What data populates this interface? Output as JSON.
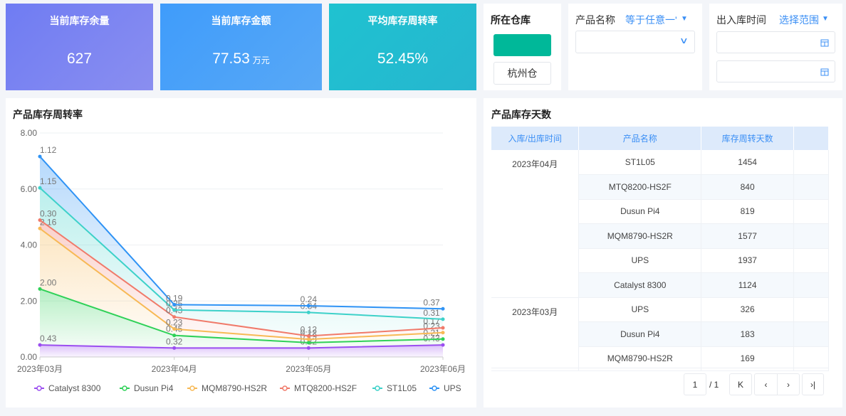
{
  "kpis": [
    {
      "title": "当前库存余量",
      "value": "627",
      "unit": ""
    },
    {
      "title": "当前库存金额",
      "value": "77.53",
      "unit": "万元"
    },
    {
      "title": "平均库存周转率",
      "value": "52.45%",
      "unit": ""
    }
  ],
  "filters": {
    "warehouse": {
      "label": "所在仓库",
      "option": "杭州仓"
    },
    "product": {
      "label": "产品名称",
      "mode": "等于任意一'",
      "value": ""
    },
    "time": {
      "label": "出入库时间",
      "mode": "选择范围",
      "start": "",
      "end": ""
    }
  },
  "chart_title": "产品库存周转率",
  "chart_data": {
    "type": "area",
    "stacked": true,
    "title": "产品库存周转率",
    "x": [
      "2023年03月",
      "2023年04月",
      "2023年05月",
      "2023年06月"
    ],
    "ylim": [
      0,
      8
    ],
    "yticks": [
      "0.00",
      "2.00",
      "4.00",
      "6.00",
      "8.00"
    ],
    "legend_position": "bottom",
    "series": [
      {
        "name": "Catalyst 8300",
        "color": "#9b4ef0",
        "values": [
          0.43,
          0.32,
          0.32,
          0.43
        ]
      },
      {
        "name": "Dusun Pi4",
        "color": "#2fd158",
        "values": [
          2.0,
          0.45,
          0.19,
          0.21
        ]
      },
      {
        "name": "MQM8790-HS2R",
        "color": "#f7b955",
        "values": [
          2.16,
          0.23,
          0.12,
          0.23
        ]
      },
      {
        "name": "MTQ8200-HS2F",
        "color": "#f07a6a",
        "values": [
          0.3,
          0.43,
          0.12,
          0.17
        ]
      },
      {
        "name": "ST1L05",
        "color": "#3dd1c9",
        "values": [
          1.15,
          0.25,
          0.84,
          0.31
        ]
      },
      {
        "name": "UPS",
        "color": "#2f93f5",
        "values": [
          1.12,
          0.19,
          0.24,
          0.37
        ]
      }
    ]
  },
  "table": {
    "title": "产品库存天数",
    "headers": [
      "入库/出库时间",
      "产品名称",
      "库存周转天数"
    ],
    "groups": [
      {
        "time": "2023年04月",
        "rows": [
          [
            "ST1L05",
            "1454"
          ],
          [
            "MTQ8200-HS2F",
            "840"
          ],
          [
            "Dusun Pi4",
            "819"
          ],
          [
            "MQM8790-HS2R",
            "1577"
          ],
          [
            "UPS",
            "1937"
          ],
          [
            "Catalyst 8300",
            "1124"
          ]
        ]
      },
      {
        "time": "2023年03月",
        "rows": [
          [
            "UPS",
            "326"
          ],
          [
            "Dusun Pi4",
            "183"
          ],
          [
            "MQM8790-HS2R",
            "169"
          ]
        ]
      }
    ],
    "pagination": {
      "page": "1",
      "total": "/ 1"
    }
  },
  "colors": {
    "warehouse_active": "#00b899"
  }
}
